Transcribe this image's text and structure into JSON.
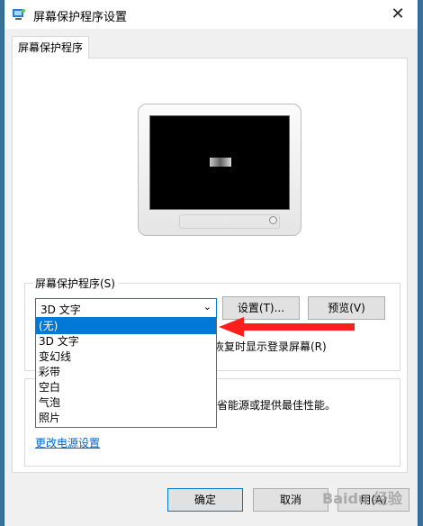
{
  "window": {
    "title": "屏幕保护程序设置"
  },
  "tab": {
    "label": "屏幕保护程序"
  },
  "screensaver_group": {
    "label": "屏幕保护程序(S)",
    "selected": "3D 文字",
    "settings_button": "设置(T)...",
    "preview_button": "预览(V)",
    "options": [
      "(无)",
      "3D 文字",
      "变幻线",
      "彩带",
      "空白",
      "气泡",
      "照片"
    ],
    "resume_text": "恢复时显示登录屏幕(R)"
  },
  "power_group": {
    "partial_text": "省能源或提供最佳性能。",
    "link": "更改电源设置"
  },
  "footer": {
    "ok": "确定",
    "cancel": "取消",
    "apply_partial": "用(A)"
  },
  "watermark": "Baidu 经验"
}
